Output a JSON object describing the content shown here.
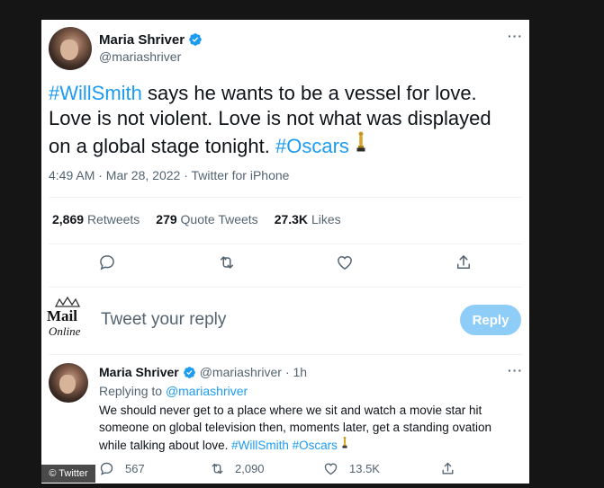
{
  "main_tweet": {
    "author_name": "Maria Shriver",
    "author_handle": "@mariashriver",
    "more_label": "···",
    "text_part1": "says he wants to be a vessel for love. Love is not violent. Love is not what was displayed on a global stage tonight.",
    "hashtag1": "#WillSmith",
    "hashtag2": "#Oscars",
    "timestamp": "4:49 AM · Mar 28, 2022 · Twitter for iPhone",
    "stats": {
      "retweets_count": "2,869",
      "retweets_label": "Retweets",
      "quotes_count": "279",
      "quotes_label": "Quote Tweets",
      "likes_count": "27.3K",
      "likes_label": "Likes"
    },
    "actions": [
      "reply-icon",
      "retweet-icon",
      "like-icon",
      "share-icon"
    ]
  },
  "composer": {
    "logo_top": "Mail",
    "logo_bottom": "Online",
    "placeholder": "Tweet your reply",
    "reply_button": "Reply"
  },
  "reply_tweet": {
    "author_name": "Maria Shriver",
    "author_handle": "@mariashriver",
    "time": "· 1h",
    "more_label": "···",
    "replying_prefix": "Replying to",
    "replying_to": "@mariashriver",
    "text": "We should never get to a place where we sit and watch a movie star hit someone on global television then, moments later, get a standing ovation while talking about love.",
    "hashtag1": "#WillSmith",
    "hashtag2": "#Oscars",
    "reply_count": "567",
    "retweet_count": "2,090",
    "like_count": "13.5K"
  },
  "watermark": "© Twitter",
  "colors": {
    "link": "#1d9bf0",
    "muted": "#536471",
    "text": "#0f1419",
    "reply_button": "#8ecdf8",
    "page_background": "#151515"
  }
}
